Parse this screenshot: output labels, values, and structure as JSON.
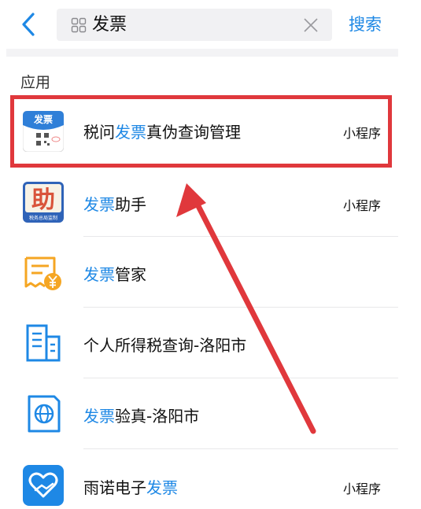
{
  "header": {
    "query": "发票",
    "search_label": "搜索"
  },
  "section": {
    "title": "应用"
  },
  "results": [
    {
      "pre": "税问",
      "hl": "发票",
      "post": "真伪查询管理",
      "tag": "小程序",
      "icon": "fapiao-qr-icon",
      "icon_text": "发票"
    },
    {
      "pre": "",
      "hl": "发票",
      "post": "助手",
      "tag": "小程序",
      "icon": "zhu-helper-icon",
      "icon_text": "助",
      "icon_sub": "税务总局监制"
    },
    {
      "pre": "",
      "hl": "发票",
      "post": "管家",
      "tag": "",
      "icon": "receipt-yuan-icon"
    },
    {
      "pre": "个人所得税查询-洛阳市",
      "hl": "",
      "post": "",
      "tag": "",
      "icon": "building-icon"
    },
    {
      "pre": "",
      "hl": "发票",
      "post": "验真-洛阳市",
      "tag": "",
      "icon": "globe-card-icon"
    },
    {
      "pre": "雨诺电子",
      "hl": "发票",
      "post": "",
      "tag": "小程序",
      "icon": "heart-hand-icon"
    }
  ],
  "colors": {
    "accent": "#1e88e5",
    "annotation": "#e0383c"
  }
}
